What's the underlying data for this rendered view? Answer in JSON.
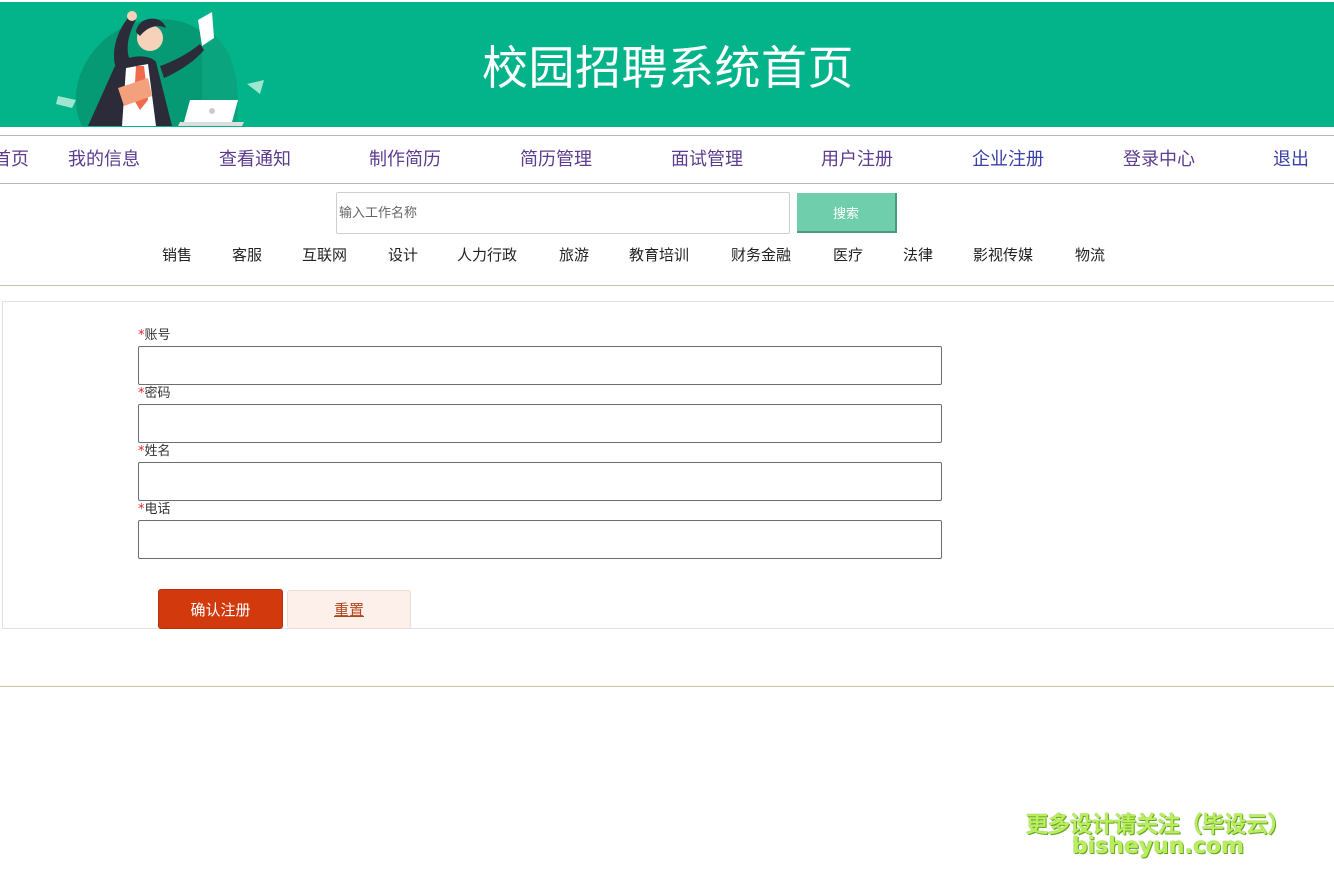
{
  "header": {
    "title": "校园招聘系统首页",
    "background_color": "#03b38a"
  },
  "nav": {
    "items": [
      {
        "label": "首页",
        "color": "#5d3b8f"
      },
      {
        "label": "我的信息",
        "color": "#5d3b8f"
      },
      {
        "label": "查看通知",
        "color": "#5d3b8f"
      },
      {
        "label": "制作简历",
        "color": "#5d3b8f"
      },
      {
        "label": "简历管理",
        "color": "#5d3b8f"
      },
      {
        "label": "面试管理",
        "color": "#5d3b8f"
      },
      {
        "label": "用户注册",
        "color": "#5d3b8f"
      },
      {
        "label": "企业注册",
        "color": "#3a3fa8"
      },
      {
        "label": "登录中心",
        "color": "#5d3b8f"
      },
      {
        "label": "退出",
        "color": "#3a3fa8"
      }
    ]
  },
  "search": {
    "placeholder": "输入工作名称",
    "value": "",
    "button_label": "搜索"
  },
  "categories": [
    "销售",
    "客服",
    "互联网",
    "设计",
    "人力行政",
    "旅游",
    "教育培训",
    "财务金融",
    "医疗",
    "法律",
    "影视传媒",
    "物流"
  ],
  "form": {
    "required_mark": "*",
    "fields": [
      {
        "label": "账号",
        "value": ""
      },
      {
        "label": "密码",
        "value": ""
      },
      {
        "label": "姓名",
        "value": ""
      },
      {
        "label": "电话",
        "value": ""
      }
    ],
    "confirm_label": "确认注册",
    "reset_label": "重置"
  },
  "watermark": {
    "line1": "更多设计请关注（毕设云）",
    "line2": "bisheyun.com"
  }
}
